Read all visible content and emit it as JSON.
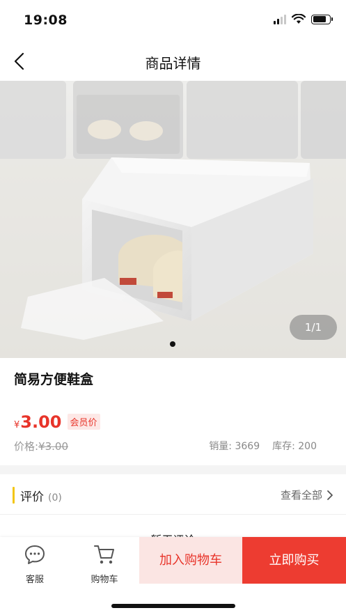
{
  "status_bar": {
    "time": "19:08"
  },
  "nav": {
    "title": "商品详情"
  },
  "gallery": {
    "counter": "1/1"
  },
  "product": {
    "name": "简易方便鞋盒",
    "currency_symbol": "¥",
    "price": "3.00",
    "member_tag": "会员价",
    "original_price_label": "价格:",
    "original_price": "¥3.00",
    "sales": "销量: 3669",
    "stock": "库存: 200"
  },
  "reviews": {
    "title": "评价",
    "count": "(0)",
    "view_all": "查看全部",
    "latest_heading": "暂无评论"
  },
  "bottom_bar": {
    "service_label": "客服",
    "cart_label": "购物车",
    "add_to_cart": "加入购物车",
    "buy_now": "立即购买"
  },
  "colors": {
    "accent_red": "#e8342a",
    "buy_button": "#ed3c31",
    "add_cart_bg": "#fbe5e3",
    "review_accent": "#f3c614"
  },
  "icons": {
    "back": "chevron-left-icon",
    "service": "chat-bubble-icon",
    "cart": "shopping-cart-icon",
    "view_all": "chevron-right-icon"
  }
}
